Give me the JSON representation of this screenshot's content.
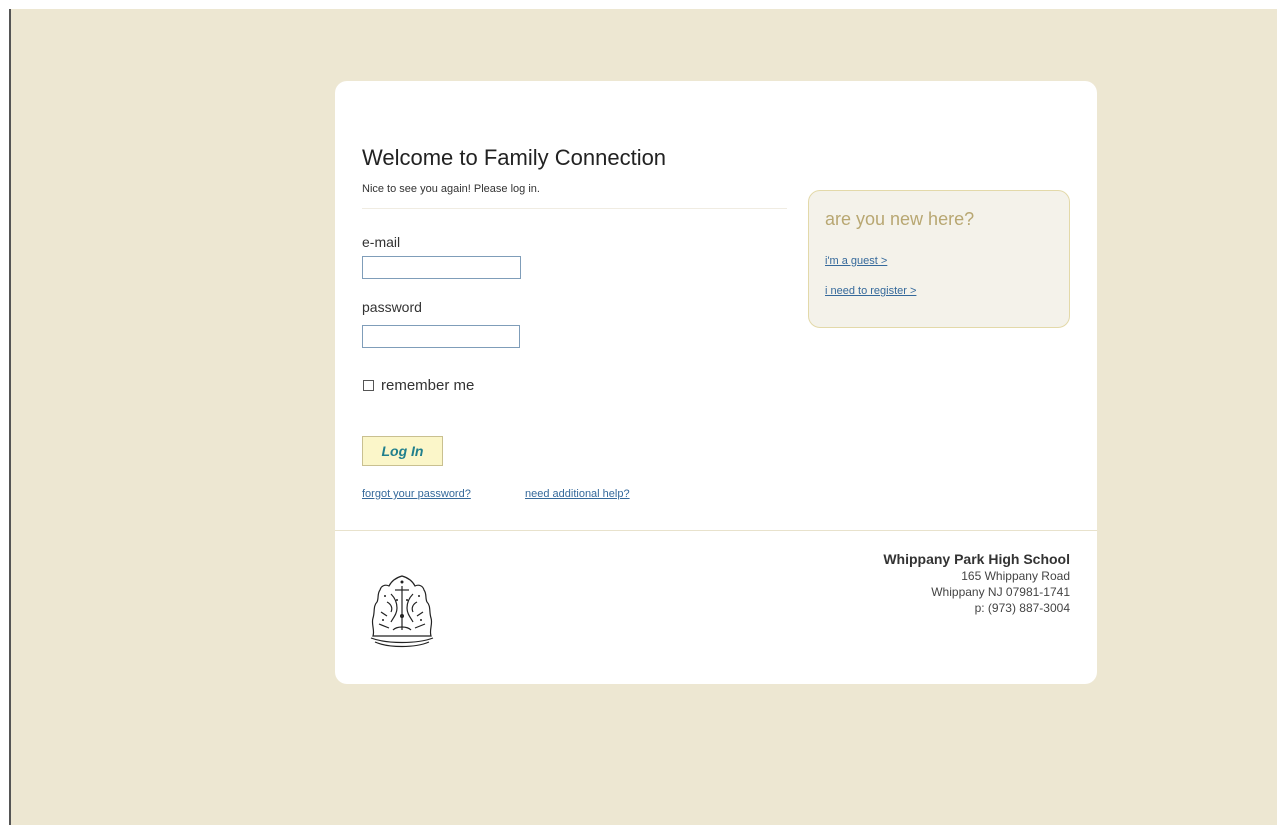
{
  "login": {
    "title": "Welcome to Family Connection",
    "subtitle": "Nice to see you again! Please log in.",
    "email_label": "e-mail",
    "email_value": "",
    "password_label": "password",
    "password_value": "",
    "remember_label": "remember me",
    "login_button": "Log In",
    "forgot_link": "forgot your password?",
    "help_link": "need additional help?"
  },
  "new_here": {
    "title": "are you new here?",
    "guest_link": "i'm a guest >",
    "register_link": "i need to register >"
  },
  "school": {
    "name": "Whippany Park High School",
    "address_line1": "165 Whippany Road",
    "address_line2": "Whippany NJ 07981-1741",
    "phone": "p: (973) 887-3004"
  },
  "colors": {
    "page_background": "#ede7d2",
    "card_background": "#ffffff",
    "link": "#35699b",
    "button_background": "#fbf6c9",
    "button_text": "#207f8d",
    "new_here_title": "#b8a772"
  },
  "icons": {
    "crest": "school-crest-icon",
    "checkbox": "checkbox-icon"
  }
}
